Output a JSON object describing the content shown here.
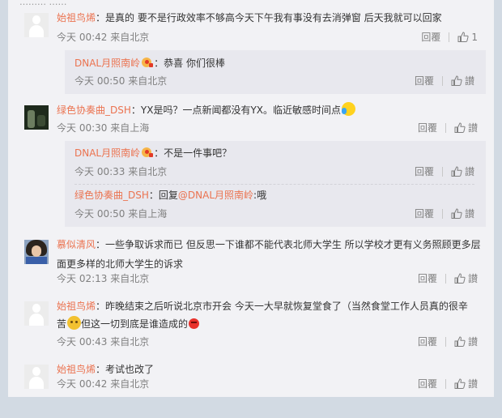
{
  "top_clip_text": "……… ……",
  "comments": [
    {
      "user": "始祖鸟烯",
      "text": "是真的 要不是行政效率不够高今天下午我有事没有去消弹窗 后天我就可以回家",
      "time": "今天 00:42 来自北京",
      "reply_label": "回覆",
      "like_count": "1",
      "replies": [
        {
          "user": "DNAL月照南岭",
          "text": "恭喜 你们很棒",
          "time": "今天 00:50 来自北京",
          "reply_label": "回覆",
          "like_label": "讃"
        }
      ]
    },
    {
      "user": "绿色协奏曲_DSH",
      "text": "YX是吗？一点新闻都没有YX。临近敏感时间点",
      "time": "今天 00:30 来自上海",
      "reply_label": "回覆",
      "like_label": "讃",
      "replies": [
        {
          "user": "DNAL月照南岭",
          "text": "不是一件事吧？",
          "time": "今天 00:33 来自北京",
          "reply_label": "回覆",
          "like_label": "讃"
        },
        {
          "user": "绿色协奏曲_DSH",
          "prefix": "回复",
          "mention": "@DNAL月照南岭",
          "text": ":哦",
          "time": "今天 00:50 来自上海",
          "reply_label": "回覆",
          "like_label": "讃"
        }
      ]
    },
    {
      "user": "慕似清风",
      "text": "一些争取诉求而已 但反思一下谁都不能代表北师大学生 所以学校才更有义务照顾更多层面更多样的北师大学生的诉求",
      "time": "今天 02:13 来自北京",
      "reply_label": "回覆",
      "like_label": "讃"
    },
    {
      "user": "始祖鸟烯",
      "text_line1": "昨晚结束之后听说北京市开会 今天一大早就恢复堂食了（当然食堂工作人员真的很辛",
      "text_line2a": "苦",
      "text_line2b": "但这一切到底是谁造成的",
      "time": "今天 00:43 来自北京",
      "reply_label": "回覆",
      "like_label": "讃"
    },
    {
      "user": "始祖鸟烯",
      "text": "考试也改了",
      "time": "今天 00:42 来自北京",
      "reply_label": "回覆",
      "like_label": "讃"
    }
  ],
  "icons": {
    "like": "thumbs-up-icon",
    "avatar_default": "default-avatar-icon"
  },
  "colors": {
    "username": "#eb7350",
    "meta": "#808080",
    "background": "#d2dae3",
    "card": "#f2f2f5",
    "reply_box": "#e8e8ee"
  }
}
